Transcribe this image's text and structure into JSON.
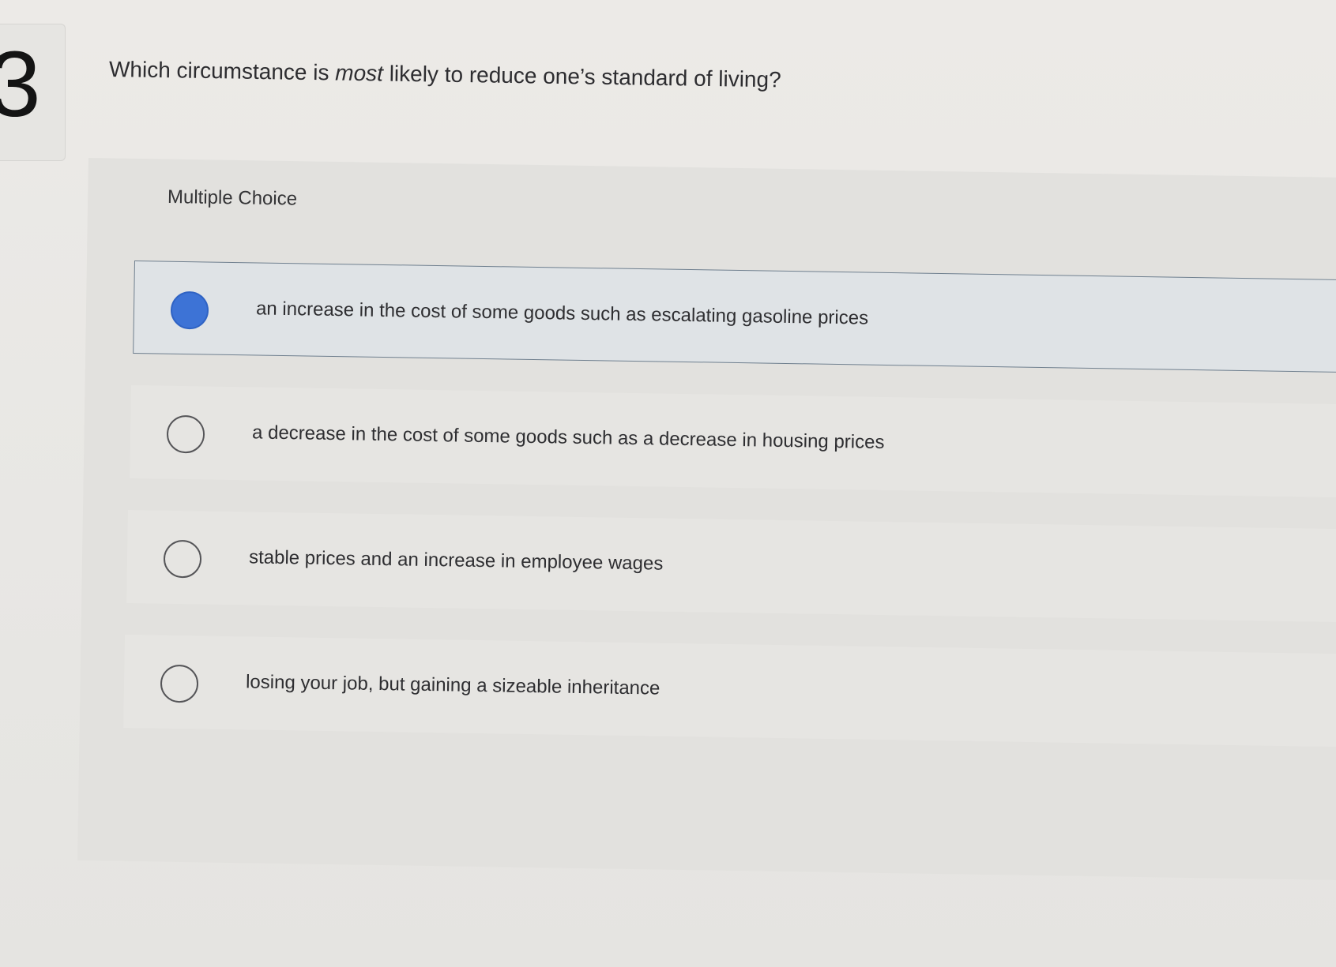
{
  "question": {
    "number": "3",
    "text_before": "Which circumstance is ",
    "text_emphasis": "most",
    "text_after": " likely to reduce one’s standard of living?"
  },
  "choice_type_label": "Multiple Choice",
  "options": [
    {
      "label": "an increase in the cost of some goods such as escalating gasoline prices",
      "selected": true
    },
    {
      "label": "a decrease in the cost of some goods such as a decrease in housing prices",
      "selected": false
    },
    {
      "label": "stable prices and an increase in employee wages",
      "selected": false
    },
    {
      "label": "losing your job, but gaining a sizeable inheritance",
      "selected": false
    }
  ],
  "colors": {
    "selected_radio": "#3d73d6",
    "selected_border": "#6f7f8e",
    "text": "#2e2e31"
  }
}
